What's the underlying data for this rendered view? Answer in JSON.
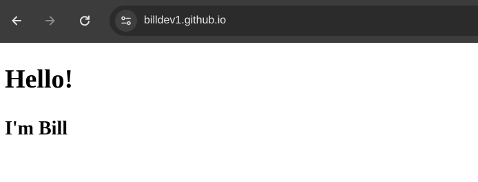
{
  "browser": {
    "url": "billdev1.github.io",
    "icons": {
      "back": "back-arrow-icon",
      "forward": "forward-arrow-icon",
      "reload": "reload-icon",
      "site_info": "site-settings-icon"
    },
    "colors": {
      "toolbar": "#3c3c3c",
      "omnibox": "#2b2b2b",
      "icon_active": "#e3e3e3",
      "icon_disabled": "#8a8a8a"
    }
  },
  "page": {
    "heading": "Hello!",
    "subheading": "I'm Bill"
  }
}
